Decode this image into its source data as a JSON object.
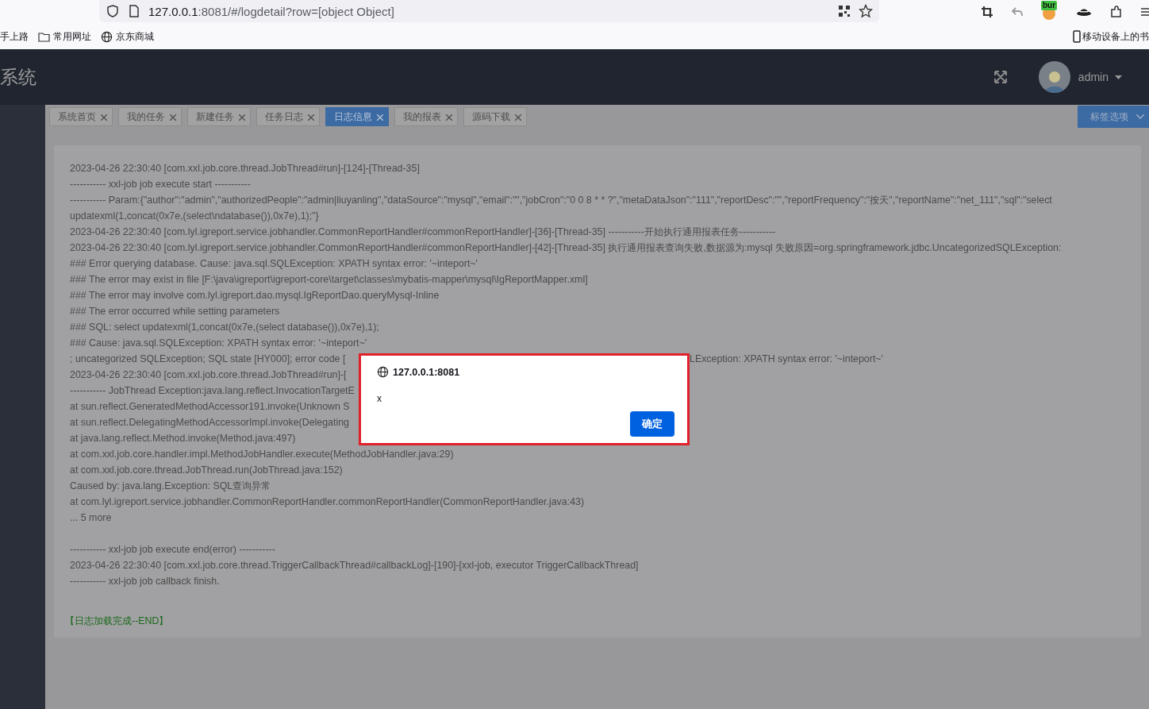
{
  "browser": {
    "url_host": "127.0.0.1",
    "url_rest": ":8081/#/logdetail?row=[object Object]",
    "extension_badge": "bur",
    "bookmarks": [
      {
        "label": "手上路",
        "kind": "plain"
      },
      {
        "label": "常用网址",
        "kind": "folder"
      },
      {
        "label": "京东商城",
        "kind": "globe"
      }
    ],
    "mobile_bookmarks": "移动设备上的书"
  },
  "header": {
    "title": "系统",
    "user": "admin"
  },
  "tabs": [
    {
      "label": "系统首页",
      "selected": false
    },
    {
      "label": "我的任务",
      "selected": false
    },
    {
      "label": "新建任务",
      "selected": false
    },
    {
      "label": "任务日志",
      "selected": false
    },
    {
      "label": "日志信息",
      "selected": true
    },
    {
      "label": "我的报表",
      "selected": false
    },
    {
      "label": "源码下载",
      "selected": false
    }
  ],
  "tab_options": "标签选项",
  "log": {
    "lines": [
      {
        "kind": "line",
        "text": "2023-04-26 22:30:40 [com.xxl.job.core.thread.JobThread#run]-[124]-[Thread-35]"
      },
      {
        "kind": "line",
        "text": "----------- xxl-job job execute start -----------"
      },
      {
        "kind": "line",
        "text": "----------- Param:{\"author\":\"admin\",\"authorizedPeople\":\"admin|liuyanling\",\"dataSource\":\"mysql\",\"email\":\"\",\"jobCron\":\"0 0 8 * * ?\",\"metaDataJson\":\"111\",\"reportDesc\":\"\",\"reportFrequency\":\"按天\",\"reportName\":\"net_111\",\"sql\":\"select updatexml(1,concat(0x7e,(select\\ndatabase()),0x7e),1);\"}"
      },
      {
        "kind": "line",
        "text": "2023-04-26 22:30:40 [com.lyl.igreport.service.jobhandler.CommonReportHandler#commonReportHandler]-[36]-[Thread-35] -----------开始执行通用报表任务-----------"
      },
      {
        "kind": "line",
        "text": "2023-04-26 22:30:40 [com.lyl.igreport.service.jobhandler.CommonReportHandler#commonReportHandler]-[42]-[Thread-35] 执行通用报表查询失败,数据源为:mysql 失败原因=org.springframework.jdbc.UncategorizedSQLException:"
      },
      {
        "kind": "line",
        "text": "### Error querying database. Cause: java.sql.SQLException: XPATH syntax error: '~inteport~'"
      },
      {
        "kind": "line",
        "text": "### The error may exist in file [F:\\java\\igreport\\igreport-core\\target\\classes\\mybatis-mapper\\mysql\\IgReportMapper.xml]"
      },
      {
        "kind": "line",
        "text": "### The error may involve com.lyl.igreport.dao.mysql.IgReportDao.queryMysql-Inline"
      },
      {
        "kind": "line",
        "text": "### The error occurred while setting parameters"
      },
      {
        "kind": "line",
        "text": "### SQL: select updatexml(1,concat(0x7e,(select database()),0x7e),1);"
      },
      {
        "kind": "line",
        "text": "### Cause: java.sql.SQLException: XPATH syntax error: '~inteport~'"
      },
      {
        "kind": "cut",
        "text": "; uncategorized SQLException; SQL state [HY000]; error code [",
        "right": "LException: XPATH syntax error: '~inteport~'"
      },
      {
        "kind": "cut",
        "text": "2023-04-26 22:30:40 [com.xxl.job.core.thread.JobThread#run]-["
      },
      {
        "kind": "cut",
        "text": "----------- JobThread Exception:java.lang.reflect.InvocationTargetE"
      },
      {
        "kind": "cut",
        "text": "at sun.reflect.GeneratedMethodAccessor191.invoke(Unknown S"
      },
      {
        "kind": "cut",
        "text": "at sun.reflect.DelegatingMethodAccessorImpl.invoke(Delegating"
      },
      {
        "kind": "line",
        "text": "at java.lang.reflect.Method.invoke(Method.java:497)"
      },
      {
        "kind": "line",
        "text": "at com.xxl.job.core.handler.impl.MethodJobHandler.execute(MethodJobHandler.java:29)"
      },
      {
        "kind": "line",
        "text": "at com.xxl.job.core.thread.JobThread.run(JobThread.java:152)"
      },
      {
        "kind": "line",
        "text": "Caused by: java.lang.Exception: SQL查询异常"
      },
      {
        "kind": "line",
        "text": "at com.lyl.igreport.service.jobhandler.CommonReportHandler.commonReportHandler(CommonReportHandler.java:43)"
      },
      {
        "kind": "line",
        "text": "... 5 more"
      },
      {
        "kind": "blank"
      },
      {
        "kind": "line",
        "text": "----------- xxl-job job execute end(error) -----------"
      },
      {
        "kind": "line",
        "text": "2023-04-26 22:30:40 [com.xxl.job.core.thread.TriggerCallbackThread#callbackLog]-[190]-[xxl-job, executor TriggerCallbackThread]"
      },
      {
        "kind": "line",
        "text": "----------- xxl-job job callback finish."
      },
      {
        "kind": "blank"
      },
      {
        "kind": "end",
        "text": "【日志加载完成--END】"
      }
    ]
  },
  "dialog": {
    "origin": "127.0.0.1:8081",
    "message": "x",
    "button": "确定"
  }
}
